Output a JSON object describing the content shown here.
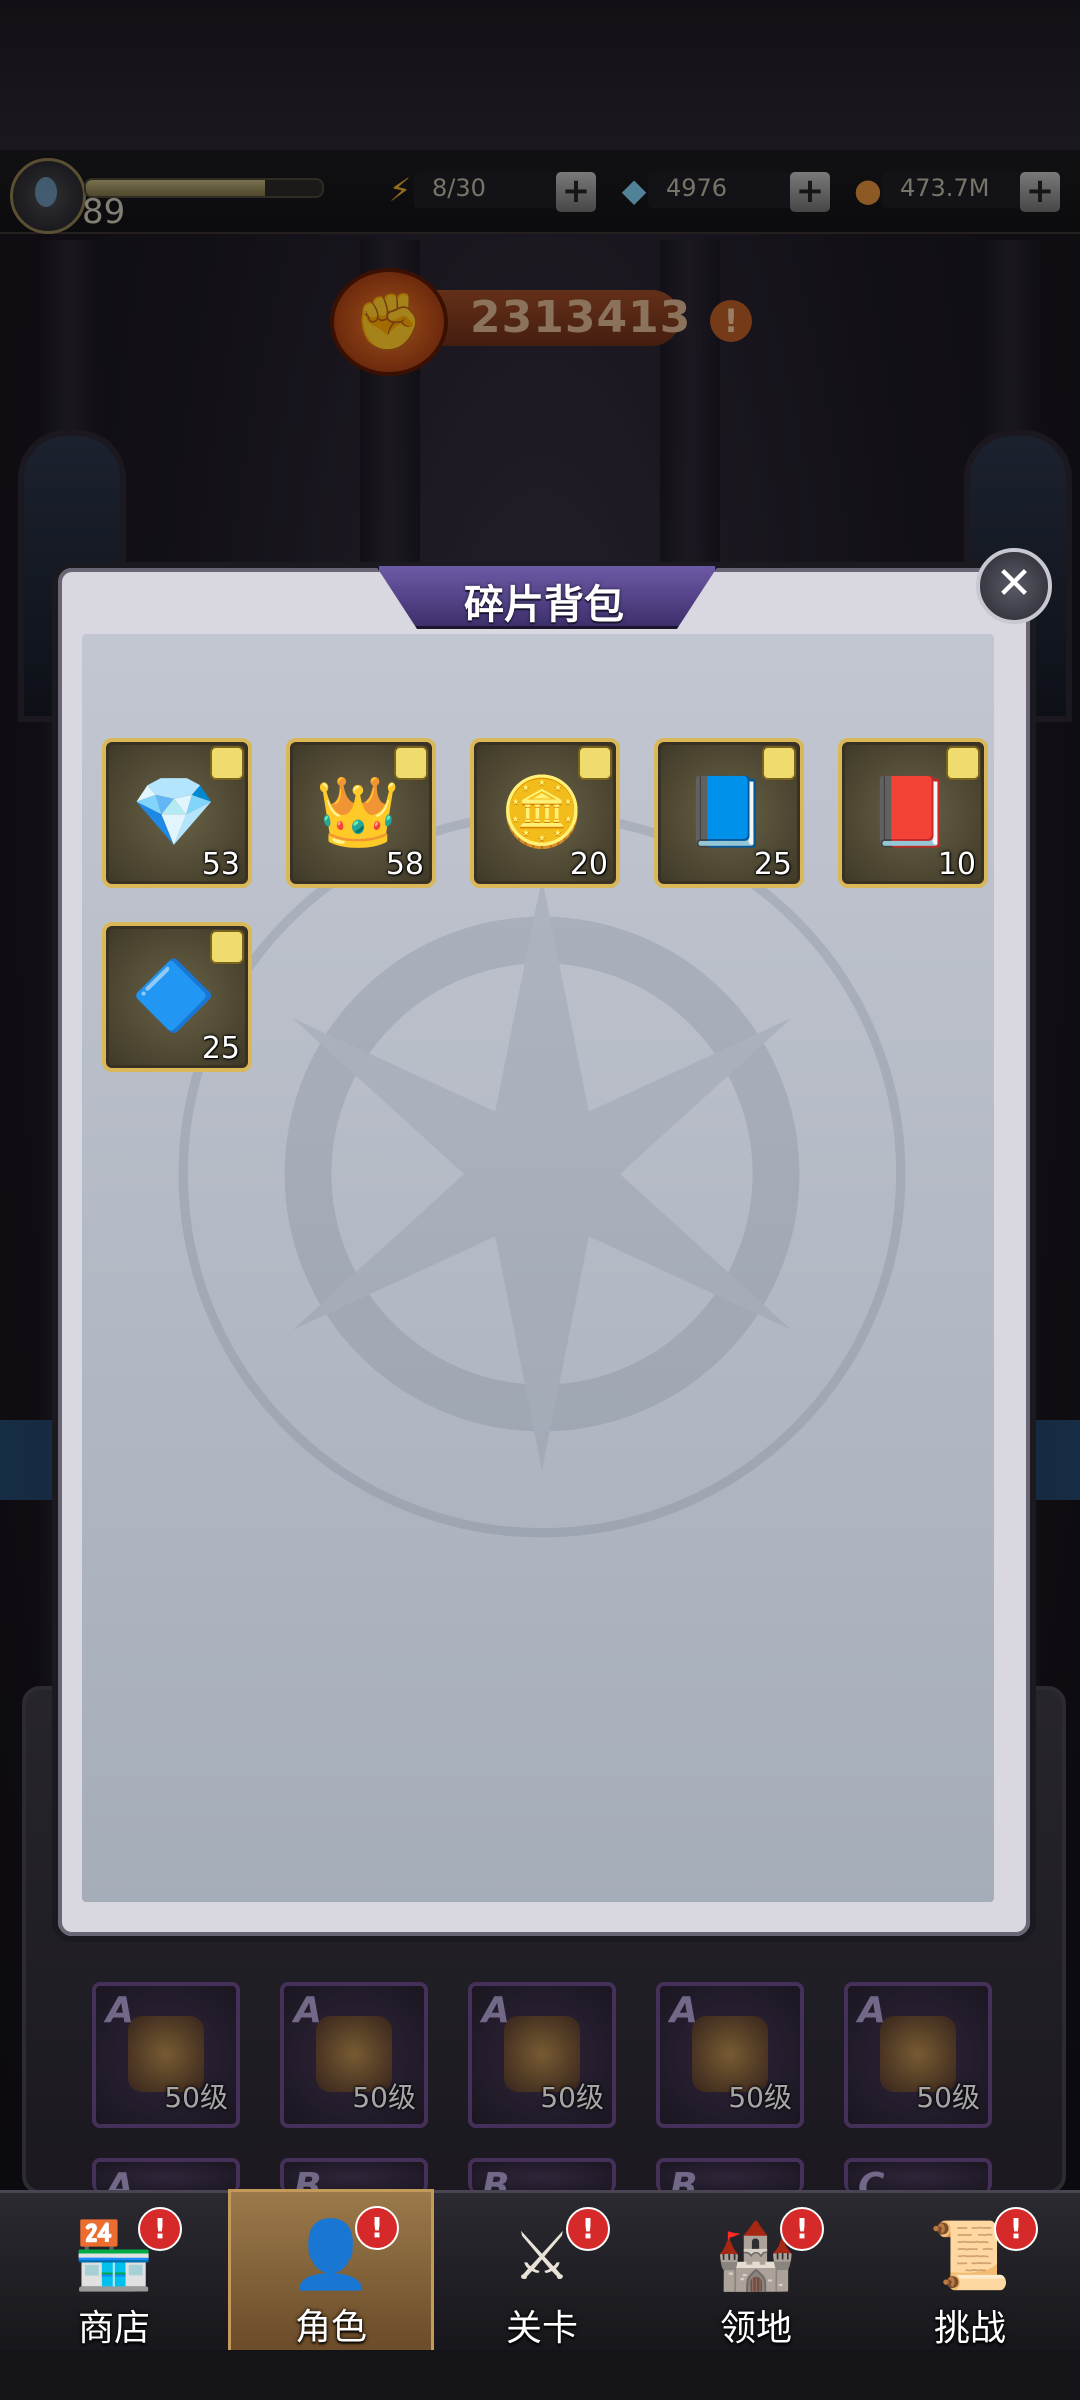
{
  "status_bar": {
    "level": "89",
    "xp_fraction": 0.76,
    "energy": "8/30",
    "gems": "4976",
    "gold": "473.7M"
  },
  "power": {
    "value": "2313413"
  },
  "dialog": {
    "title": "碎片背包",
    "close_icon": "close-icon",
    "items": [
      {
        "name": "crystal-shard-icon",
        "glyph": "💎",
        "count": "53"
      },
      {
        "name": "crown-icon",
        "glyph": "👑",
        "count": "58"
      },
      {
        "name": "coin-icon",
        "glyph": "🪙",
        "count": "20"
      },
      {
        "name": "magic-book-icon",
        "glyph": "📘",
        "count": "25"
      },
      {
        "name": "spell-tome-icon",
        "glyph": "📕",
        "count": "10"
      },
      {
        "name": "amulet-icon",
        "glyph": "🔷",
        "count": "25"
      }
    ]
  },
  "underlay": {
    "cards": [
      {
        "grade": "A",
        "level": "50级"
      },
      {
        "grade": "A",
        "level": "50级"
      },
      {
        "grade": "A",
        "level": "50级"
      },
      {
        "grade": "A",
        "level": "50级"
      },
      {
        "grade": "A",
        "level": "50级"
      }
    ],
    "next_row_grades": [
      "A",
      "B",
      "B",
      "B",
      "C"
    ]
  },
  "nav": {
    "items": [
      {
        "label": "商店",
        "icon": "shop-icon",
        "glyph": "🏪",
        "badge": "!"
      },
      {
        "label": "角色",
        "icon": "character-icon",
        "glyph": "👤",
        "badge": "!"
      },
      {
        "label": "关卡",
        "icon": "crossed-swords-icon",
        "glyph": "⚔",
        "badge": "!"
      },
      {
        "label": "领地",
        "icon": "castle-icon",
        "glyph": "🏰",
        "badge": "!"
      },
      {
        "label": "挑战",
        "icon": "scroll-icon",
        "glyph": "📜",
        "badge": "!"
      }
    ]
  },
  "colors": {
    "accent_gold": "#d9b85a",
    "title_purple": "#5a4a90",
    "badge_red": "#d62a2a"
  }
}
